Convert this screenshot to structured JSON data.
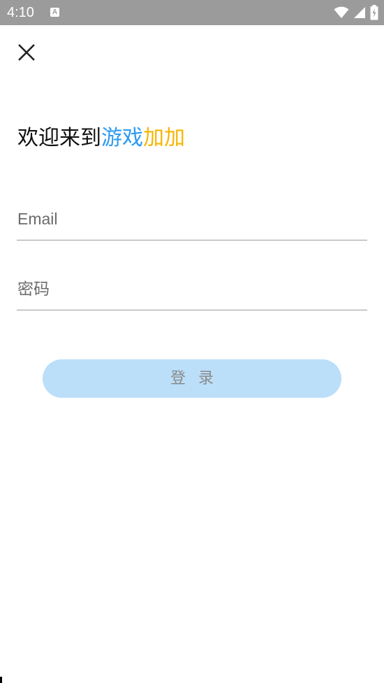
{
  "status_bar": {
    "time": "4:10",
    "notification_badge": "A",
    "icons": [
      "wifi-icon",
      "cell-signal-icon",
      "battery-charging-icon"
    ]
  },
  "header": {
    "close_icon": "close-icon"
  },
  "headline": {
    "prefix": "欢迎来到",
    "highlight_blue": "游戏",
    "highlight_gold": "加加"
  },
  "form": {
    "email_placeholder": "Email",
    "email_value": "",
    "password_placeholder": "密码",
    "password_value": "",
    "login_label": "登录"
  },
  "colors": {
    "status_bar": "#9b9b9b",
    "brand_blue": "#2b9af3",
    "brand_gold": "#f7b500",
    "login_button_bg": "#bcdff9",
    "login_button_text": "#8a8a8a",
    "divider": "#9a9a9a"
  }
}
